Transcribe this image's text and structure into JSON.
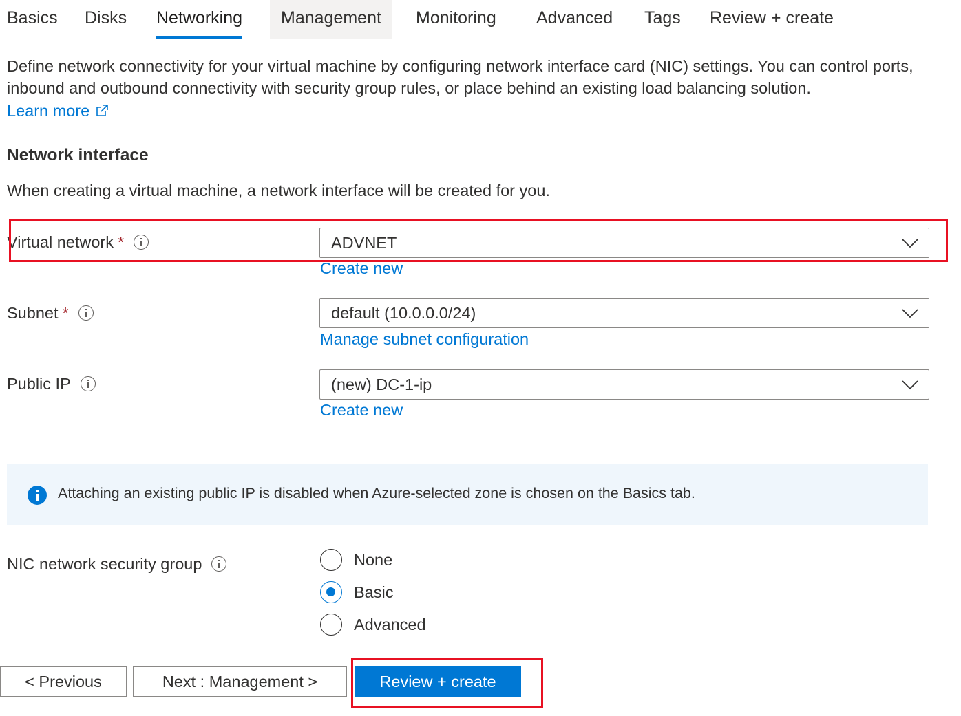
{
  "tabs": [
    {
      "label": "Basics"
    },
    {
      "label": "Disks"
    },
    {
      "label": "Networking"
    },
    {
      "label": "Management"
    },
    {
      "label": "Monitoring"
    },
    {
      "label": "Advanced"
    },
    {
      "label": "Tags"
    },
    {
      "label": "Review + create"
    }
  ],
  "active_tab": "Networking",
  "intro": {
    "description": "Define network connectivity for your virtual machine by configuring network interface card (NIC) settings. You can control ports, inbound and outbound connectivity with security group rules, or place behind an existing load balancing solution.",
    "learn_more": "Learn more"
  },
  "network_interface": {
    "title": "Network interface",
    "description": "When creating a virtual machine, a network interface will be created for you."
  },
  "fields": {
    "virtual_network": {
      "label": "Virtual network",
      "required": "*",
      "value": "ADVNET",
      "link": "Create new"
    },
    "subnet": {
      "label": "Subnet",
      "required": "*",
      "value": "default (10.0.0.0/24)",
      "link": "Manage subnet configuration"
    },
    "public_ip": {
      "label": "Public IP",
      "value": "(new) DC-1-ip",
      "link": "Create new"
    }
  },
  "info_message": "Attaching an existing public IP is disabled when Azure-selected zone is chosen on the Basics tab.",
  "nsg": {
    "label": "NIC network security group",
    "options": [
      "None",
      "Basic",
      "Advanced"
    ],
    "selected": "Basic"
  },
  "footer": {
    "previous": "< Previous",
    "next": "Next : Management >",
    "review": "Review + create"
  },
  "colors": {
    "accent": "#0078d4",
    "highlight": "#e81123",
    "info_bg": "#eff6fc"
  }
}
